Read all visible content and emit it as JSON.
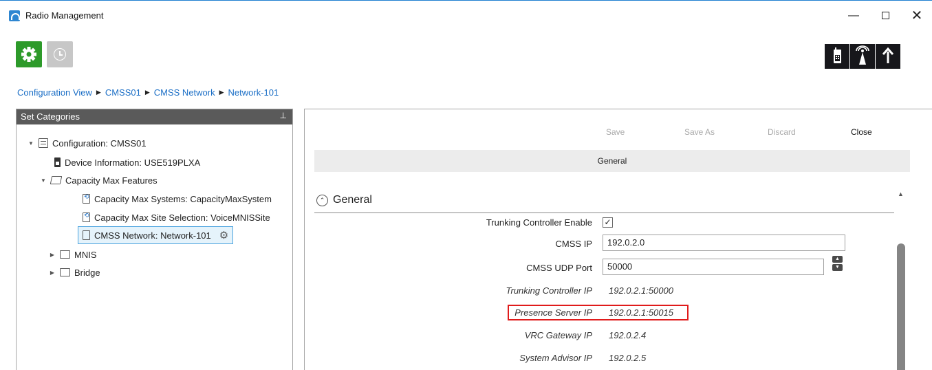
{
  "window": {
    "title": "Radio Management",
    "controls": {
      "minimize": "—",
      "close": "✕"
    }
  },
  "toolbar": {
    "settings_icon": "gear-icon",
    "history_icon": "clock-icon",
    "right_icons": [
      "radio-device-icon",
      "tower-signal-icon",
      "upload-icon"
    ]
  },
  "breadcrumb": {
    "items": [
      "Configuration View",
      "CMSS01",
      "CMSS Network",
      "Network-101"
    ],
    "separator": "▶"
  },
  "left_pane": {
    "title": "Set Categories",
    "pin": "ꟸ",
    "tree": [
      {
        "label": "Configuration: CMSS01",
        "caret": "▼"
      },
      {
        "label": "Device Information: USE519PLXA"
      },
      {
        "label": "Capacity Max Features",
        "caret": "▼"
      },
      {
        "label": "Capacity Max Systems: CapacityMaxSystem"
      },
      {
        "label": "Capacity Max Site Selection: VoiceMNISSite"
      },
      {
        "label": "CMSS Network: Network-101"
      },
      {
        "label": "MNIS",
        "caret": "▶"
      },
      {
        "label": "Bridge",
        "caret": "▶"
      }
    ]
  },
  "right_pane": {
    "actions": {
      "save": "Save",
      "save_as": "Save As",
      "discard": "Discard",
      "close": "Close"
    },
    "section_header": "General",
    "group_title": "General",
    "collapse_glyph": "⌃",
    "fields": {
      "trunking_enable": {
        "label": "Trunking Controller Enable",
        "checked_glyph": "✓"
      },
      "cmss_ip": {
        "label": "CMSS IP",
        "value": "192.0.2.0"
      },
      "cmss_udp_port": {
        "label": "CMSS UDP Port",
        "value": "50000"
      },
      "trunking_ip": {
        "label": "Trunking Controller IP",
        "value": "192.0.2.1:50000"
      },
      "presence_ip": {
        "label": "Presence Server IP",
        "value": "192.0.2.1:50015"
      },
      "vrc_ip": {
        "label": "VRC Gateway IP",
        "value": "192.0.2.4"
      },
      "advisor_ip": {
        "label": "System Advisor IP",
        "value": "192.0.2.5"
      }
    },
    "colors": {
      "highlight": "#e01b1b",
      "accent": "#1c6fc6",
      "settings_green": "#2d9a2a"
    }
  }
}
